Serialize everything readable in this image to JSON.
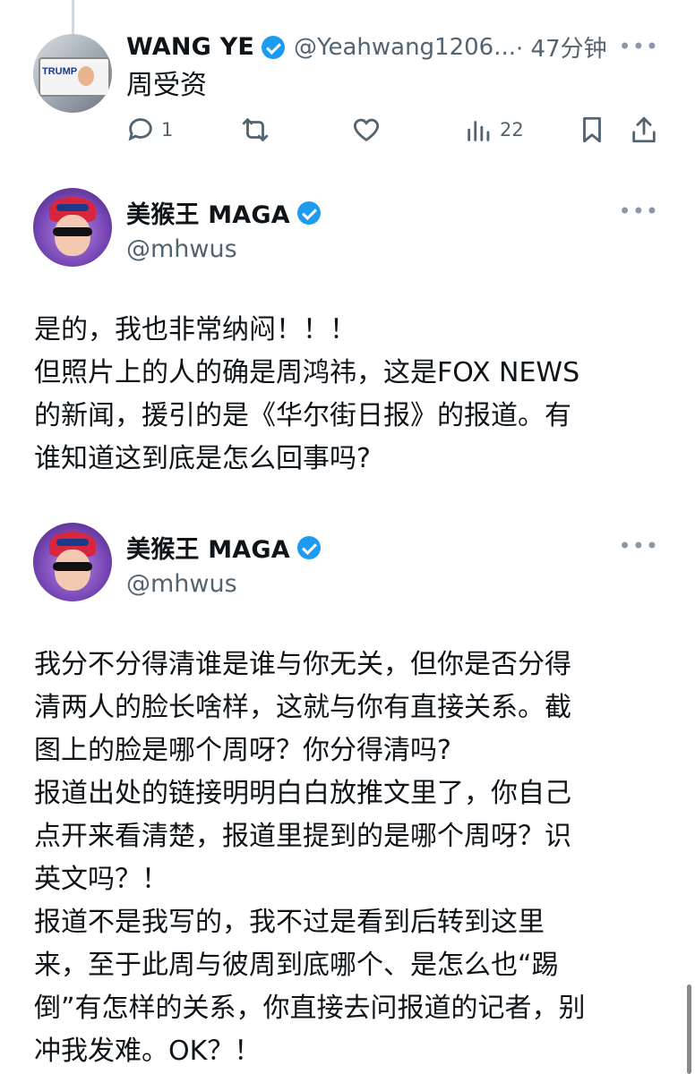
{
  "tweet1": {
    "name": "WANG YE",
    "handle": "@Yeahwang1206...",
    "time": "· 47分钟",
    "text": "周受资",
    "avatar_text": "TRUMP",
    "replies": "1",
    "views": "22"
  },
  "tweet2": {
    "name": "美猴王 MAGA",
    "handle": "@mhwus",
    "lines": [
      "是的，我也非常纳闷！！！",
      "但照片上的人的确是周鸿祎，这是FOX NEWS",
      "的新闻，援引的是《华尔街日报》的报道。有",
      "谁知道这到底是怎么回事吗?"
    ]
  },
  "tweet3": {
    "name": "美猴王 MAGA",
    "handle": "@mhwus",
    "lines": [
      "我分不分得清谁是谁与你无关，但你是否分得",
      "清两人的脸长啥样，这就与你有直接关系。截",
      "图上的脸是哪个周呀？你分得清吗?",
      "报道出处的链接明明白白放推文里了，你自己",
      "点开来看清楚，报道里提到的是哪个周呀？识",
      "英文吗？！",
      "报道不是我写的，我不过是看到后转到这里",
      "来，至于此周与彼周到底哪个、是怎么也“踢",
      "倒”有怎样的关系，你直接去问报道的记者，别",
      "冲我发难。OK？！"
    ]
  },
  "more_glyph": "•••",
  "colors": {
    "accent": "#1d9bf0",
    "secondary_text": "#536471",
    "divider": "#cfd9de"
  }
}
